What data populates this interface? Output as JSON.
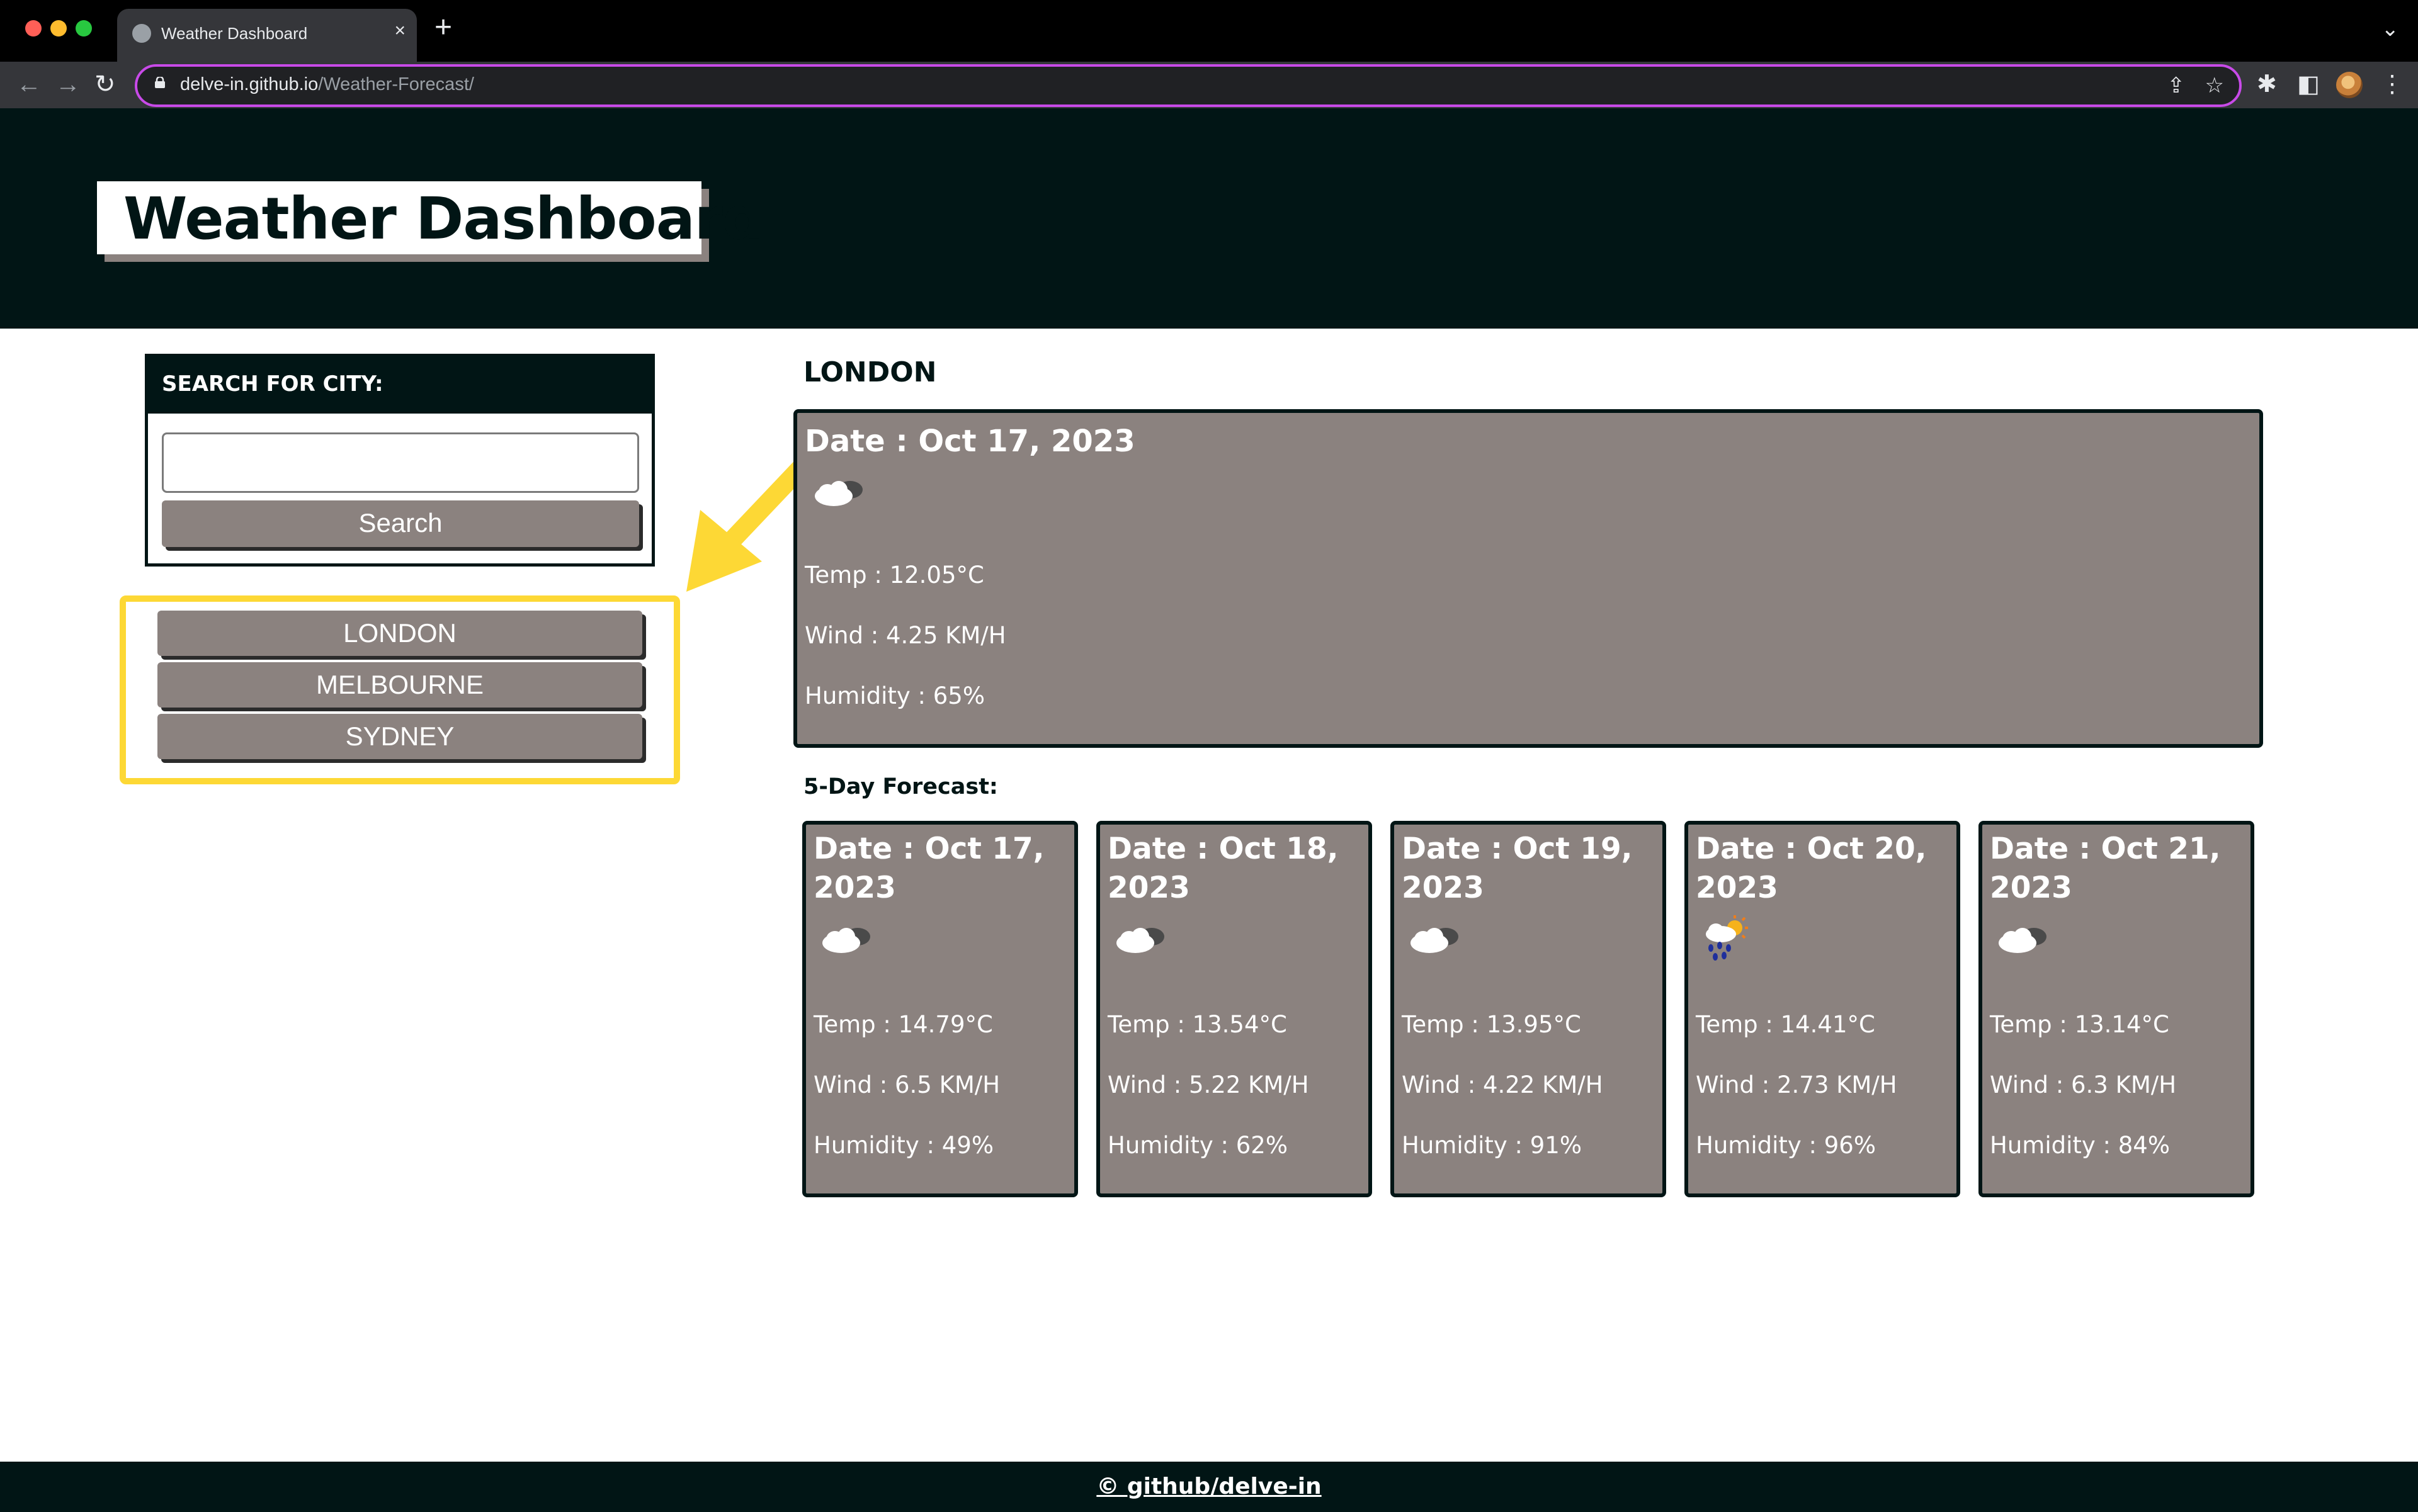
{
  "browser": {
    "tab_title": "Weather Dashboard",
    "url_host": "delve-in.github.io",
    "url_path": "/Weather-Forecast/",
    "tab_close_glyph": "×",
    "new_tab_glyph": "+",
    "tab_menu_glyph": "⌄",
    "back_glyph": "←",
    "forward_glyph": "→",
    "reload_glyph": "↻",
    "share_glyph": "⇪",
    "bookmark_glyph": "☆",
    "extensions_glyph": "✱",
    "sidepanel_glyph": "◧",
    "menu_glyph": "⋮"
  },
  "header": {
    "title": "Weather Dashboard"
  },
  "search": {
    "heading": "SEARCH FOR CITY:",
    "input_value": "",
    "button_label": "Search"
  },
  "history": [
    "LONDON",
    "MELBOURNE",
    "SYDNEY"
  ],
  "current": {
    "city": "LONDON",
    "date": "Date : Oct 17, 2023",
    "icon": "cloudy-icon",
    "temp": "Temp : 12.05°C",
    "wind": "Wind : 4.25 KM/H",
    "humidity": "Humidity : 65%"
  },
  "forecast_heading": "5-Day Forecast:",
  "forecast": [
    {
      "date_line1": "Date : Oct 17,",
      "date_line2": "2023",
      "icon": "cloudy-icon",
      "temp": "Temp : 14.79°C",
      "wind": "Wind : 6.5 KM/H",
      "humidity": "Humidity : 49%"
    },
    {
      "date_line1": "Date : Oct 18,",
      "date_line2": "2023",
      "icon": "cloudy-icon",
      "temp": "Temp : 13.54°C",
      "wind": "Wind : 5.22 KM/H",
      "humidity": "Humidity : 62%"
    },
    {
      "date_line1": "Date : Oct 19,",
      "date_line2": "2023",
      "icon": "cloudy-icon",
      "temp": "Temp : 13.95°C",
      "wind": "Wind : 4.22 KM/H",
      "humidity": "Humidity : 91%"
    },
    {
      "date_line1": "Date : Oct 20,",
      "date_line2": "2023",
      "icon": "rain-sun-icon",
      "temp": "Temp : 14.41°C",
      "wind": "Wind : 2.73 KM/H",
      "humidity": "Humidity : 96%"
    },
    {
      "date_line1": "Date : Oct 21,",
      "date_line2": "2023",
      "icon": "cloudy-icon",
      "temp": "Temp : 13.14°C",
      "wind": "Wind : 6.3 KM/H",
      "humidity": "Humidity : 84%"
    }
  ],
  "footer": {
    "link": "© github/delve-in"
  },
  "colors": {
    "header_bg": "#011515",
    "card_bg": "#8b827f",
    "highlight": "#fdd835",
    "omnibox_border": "#c84ae8"
  }
}
